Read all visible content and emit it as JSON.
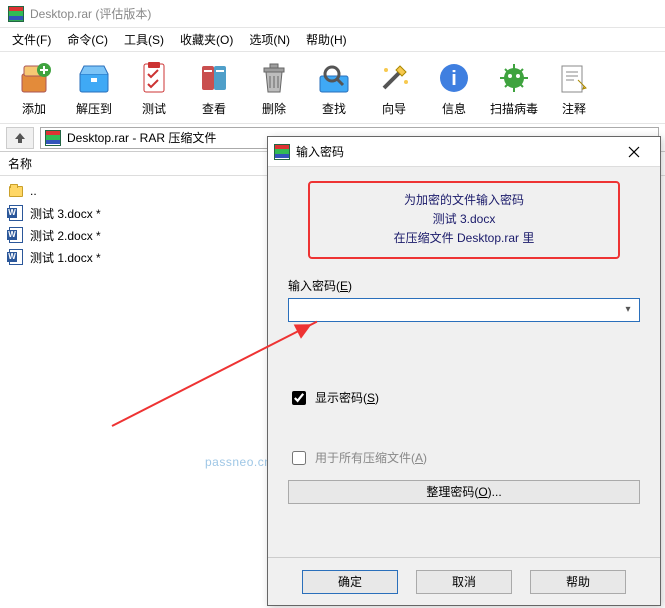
{
  "window": {
    "title": "Desktop.rar (评估版本)"
  },
  "menu": {
    "file": "文件(F)",
    "cmd": "命令(C)",
    "tools": "工具(S)",
    "fav": "收藏夹(O)",
    "opt": "选项(N)",
    "help": "帮助(H)"
  },
  "toolbar": {
    "add": "添加",
    "extract": "解压到",
    "test": "测试",
    "view": "查看",
    "delete": "删除",
    "find": "查找",
    "wizard": "向导",
    "info": "信息",
    "scan": "扫描病毒",
    "comment": "注释"
  },
  "address": {
    "path": "Desktop.rar - RAR 压缩文件"
  },
  "columns": {
    "name": "名称"
  },
  "files": {
    "up": "..",
    "items": [
      {
        "name": "测试 3.docx *"
      },
      {
        "name": "测试 2.docx *"
      },
      {
        "name": "测试 1.docx *"
      }
    ]
  },
  "watermark": "passneo.cn",
  "dialog": {
    "title": "输入密码",
    "msg_l1": "为加密的文件输入密码",
    "msg_l2": "测试 3.docx",
    "msg_l3": "在压缩文件 Desktop.rar 里",
    "field_label_pre": "输入密码(",
    "field_label_key": "E",
    "field_label_post": ")",
    "show_pre": "显示密码(",
    "show_key": "S",
    "show_post": ")",
    "all_pre": "用于所有压缩文件(",
    "all_key": "A",
    "all_post": ")",
    "organize_pre": "整理密码(",
    "organize_key": "O",
    "organize_post": ")...",
    "ok": "确定",
    "cancel": "取消",
    "help": "帮助"
  }
}
